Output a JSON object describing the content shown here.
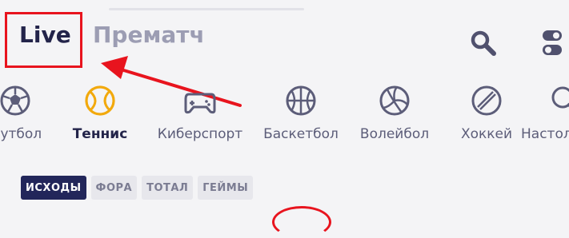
{
  "header": {
    "tabs": [
      {
        "label": "Live"
      },
      {
        "label": "Прематч"
      }
    ]
  },
  "sports": [
    {
      "label": "Футбол",
      "icon": "soccer-ball-icon"
    },
    {
      "label": "Теннис",
      "icon": "tennis-ball-icon"
    },
    {
      "label": "Киберспорт",
      "icon": "gamepad-icon"
    },
    {
      "label": "Баскетбол",
      "icon": "basketball-icon"
    },
    {
      "label": "Волейбол",
      "icon": "volleyball-icon"
    },
    {
      "label": "Хоккей",
      "icon": "hockey-puck-icon"
    },
    {
      "label": "Настольный теннис",
      "icon": "table-tennis-icon"
    }
  ],
  "markets": {
    "chips": [
      {
        "label": "ИСХОДЫ"
      },
      {
        "label": "ФОРА"
      },
      {
        "label": "ТОТАЛ"
      },
      {
        "label": "ГЕЙМЫ"
      }
    ]
  },
  "colors": {
    "primary": "#23244a",
    "muted": "#9c9db3",
    "accent": "#f2a90c",
    "annotation": "#e8141e",
    "chip_active": "#22265a"
  }
}
